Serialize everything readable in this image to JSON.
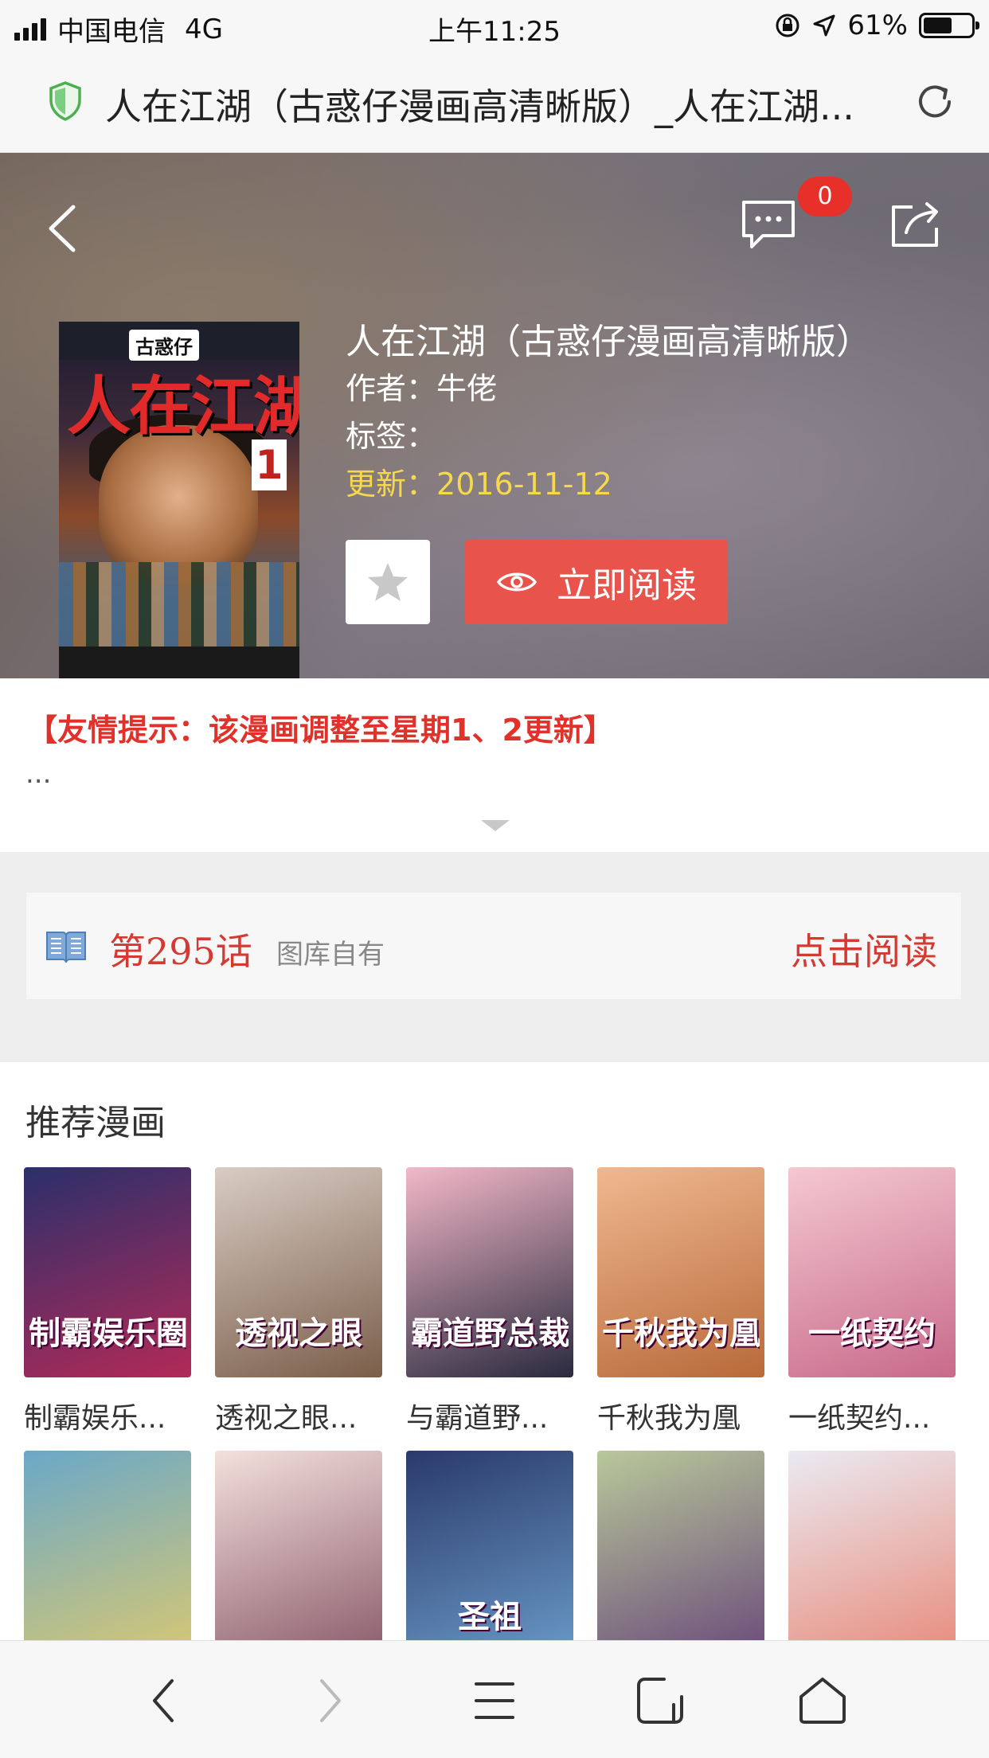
{
  "status_bar": {
    "carrier": "中国电信",
    "network": "4G",
    "time": "上午11:25",
    "battery": "61%",
    "battery_level": 0.61
  },
  "url_bar": {
    "title": "人在江湖（古惑仔漫画高清晰版）_人在江湖..."
  },
  "header": {
    "message_count": "0"
  },
  "cover": {
    "brand": "古惑仔",
    "title": "人在江湖",
    "volume": "1"
  },
  "comic": {
    "title": "人在江湖（古惑仔漫画高清晰版）",
    "author_label": "作者：",
    "author": "牛佬",
    "tags_label": "标签：",
    "tags": "",
    "update_label": "更新：",
    "update_date": "2016-11-12",
    "read_now_label": "立即阅读"
  },
  "notice": {
    "text": "【友情提示：该漫画调整至星期1、2更新】",
    "more": "..."
  },
  "chapter": {
    "title": "第295话",
    "source": "图库自有",
    "read_label": "点击阅读"
  },
  "recommend": {
    "heading": "推荐漫画",
    "items": [
      {
        "name": "制霸娱乐...",
        "thumb_text": "制霸娱乐圈",
        "colors": [
          "#2b2f6b",
          "#b22a57"
        ]
      },
      {
        "name": "透视之眼...",
        "thumb_text": "透视之眼",
        "colors": [
          "#d8ccc4",
          "#7b5e4a"
        ]
      },
      {
        "name": "与霸道野...",
        "thumb_text": "霸道野总裁",
        "colors": [
          "#f2b8c8",
          "#2a2a3e"
        ]
      },
      {
        "name": "千秋我为凰",
        "thumb_text": "千秋我为凰",
        "colors": [
          "#f0b890",
          "#b86a3a"
        ]
      },
      {
        "name": "一纸契约...",
        "thumb_text": "一纸契约",
        "colors": [
          "#f4c8d2",
          "#c86a8a"
        ]
      },
      {
        "name": "",
        "thumb_text": "",
        "colors": [
          "#6aa8c8",
          "#d8c872"
        ]
      },
      {
        "name": "",
        "thumb_text": "",
        "colors": [
          "#f3e0dc",
          "#8a5a6a"
        ]
      },
      {
        "name": "",
        "thumb_text": "圣祖",
        "colors": [
          "#2a3a6a",
          "#6a9ac8"
        ]
      },
      {
        "name": "",
        "thumb_text": "",
        "colors": [
          "#b8c89a",
          "#6a4a7a"
        ]
      },
      {
        "name": "",
        "thumb_text": "",
        "colors": [
          "#eaeaf2",
          "#e88a7a"
        ]
      }
    ]
  },
  "colors": {
    "accent_red": "#e8544b",
    "chapter_red": "#d33a32",
    "update_yellow": "#f5d94b",
    "badge_red": "#e8302a"
  }
}
